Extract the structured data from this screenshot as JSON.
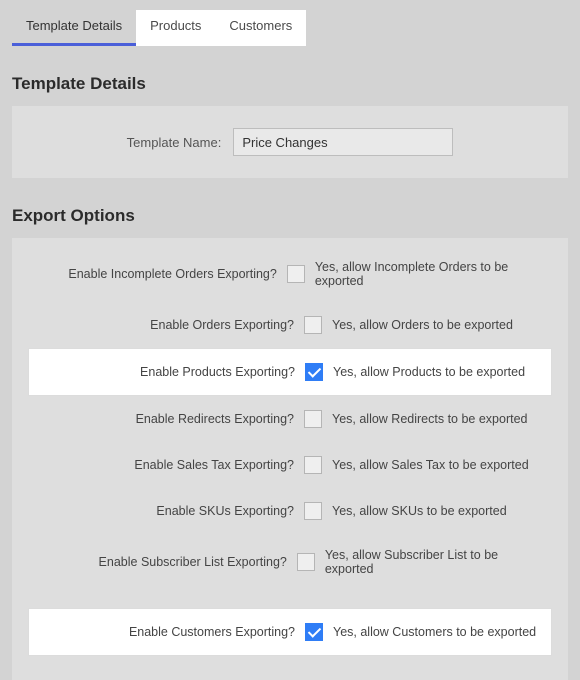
{
  "tabs": [
    {
      "label": "Template Details",
      "active": true,
      "light": false
    },
    {
      "label": "Products",
      "active": false,
      "light": true
    },
    {
      "label": "Customers",
      "active": false,
      "light": true
    }
  ],
  "section1_title": "Template Details",
  "template_name_label": "Template Name:",
  "template_name_value": "Price Changes",
  "section2_title": "Export Options",
  "options": [
    {
      "question": "Enable Incomplete Orders Exporting?",
      "text": "Yes, allow Incomplete Orders to be exported",
      "checked": false,
      "highlight": false
    },
    {
      "question": "Enable Orders Exporting?",
      "text": "Yes, allow Orders to be exported",
      "checked": false,
      "highlight": false
    },
    {
      "question": "Enable Products Exporting?",
      "text": "Yes, allow Products to be exported",
      "checked": true,
      "highlight": true
    },
    {
      "question": "Enable Redirects Exporting?",
      "text": "Yes, allow Redirects to be exported",
      "checked": false,
      "highlight": false
    },
    {
      "question": "Enable Sales Tax Exporting?",
      "text": "Yes, allow Sales Tax to be exported",
      "checked": false,
      "highlight": false
    },
    {
      "question": "Enable SKUs Exporting?",
      "text": "Yes, allow SKUs to be exported",
      "checked": false,
      "highlight": false
    },
    {
      "question": "Enable Subscriber List Exporting?",
      "text": "Yes, allow Subscriber List to be exported",
      "checked": false,
      "highlight": false
    },
    {
      "question": "Enable Customers Exporting?",
      "text": "Yes, allow Customers to be exported",
      "checked": true,
      "highlight": true
    }
  ]
}
